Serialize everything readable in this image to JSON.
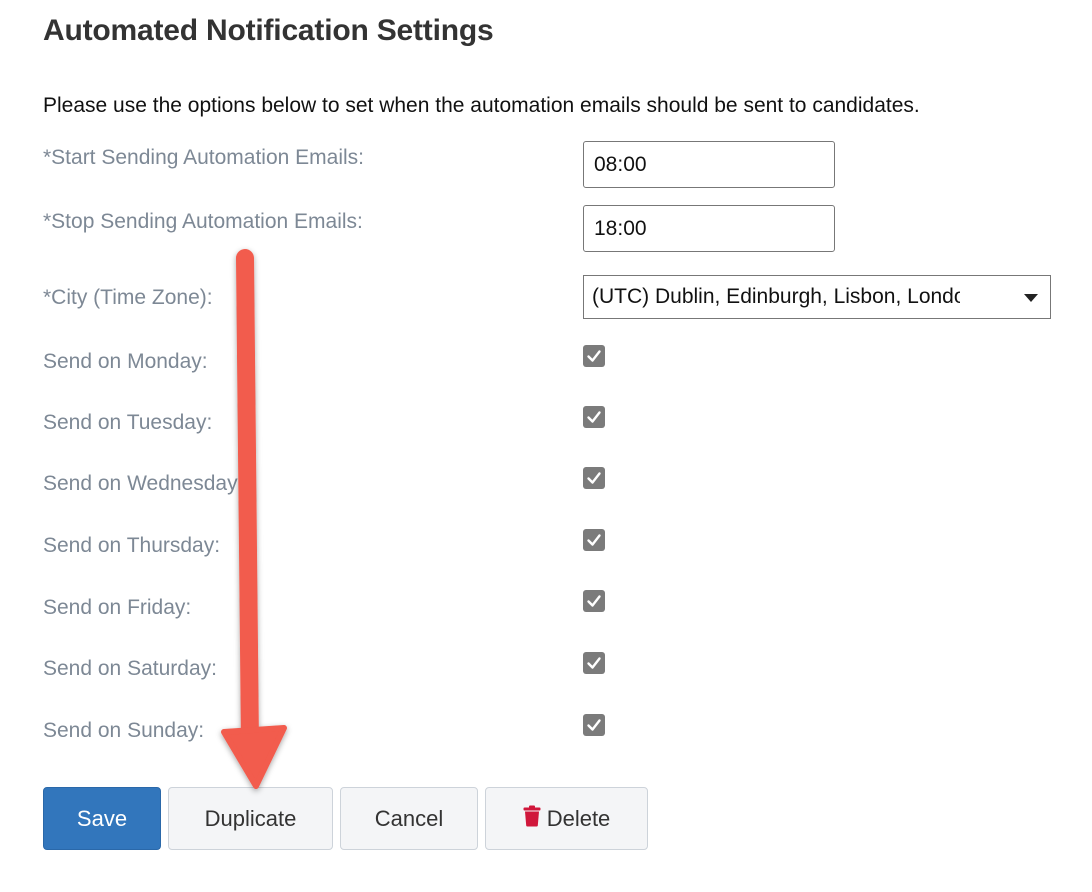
{
  "header": {
    "title": "Automated Notification Settings"
  },
  "intro": "Please use the options below to set when the automation emails should be sent to candidates.",
  "fields": {
    "start_label": "*Start Sending Automation Emails:",
    "start_value": "08:00",
    "stop_label": "*Stop Sending Automation Emails:",
    "stop_value": "18:00",
    "timezone_label": "*City (Time Zone):",
    "timezone_value": "(UTC) Dublin, Edinburgh, Lisbon, London"
  },
  "days": [
    {
      "label": "Send on Monday:",
      "checked": true
    },
    {
      "label": "Send on Tuesday:",
      "checked": true
    },
    {
      "label": "Send on Wednesday:",
      "checked": true
    },
    {
      "label": "Send on Thursday:",
      "checked": true
    },
    {
      "label": "Send on Friday:",
      "checked": true
    },
    {
      "label": "Send on Saturday:",
      "checked": true
    },
    {
      "label": "Send on Sunday:",
      "checked": true
    }
  ],
  "buttons": {
    "save": "Save",
    "duplicate": "Duplicate",
    "cancel": "Cancel",
    "delete": "Delete"
  },
  "colors": {
    "primary": "#3276bc",
    "delete_icon": "#d0173b",
    "annotation_arrow": "#f25b4d"
  },
  "icons": {
    "delete": "trash-icon",
    "select": "caret-down-icon",
    "checkbox": "checkmark-icon"
  }
}
